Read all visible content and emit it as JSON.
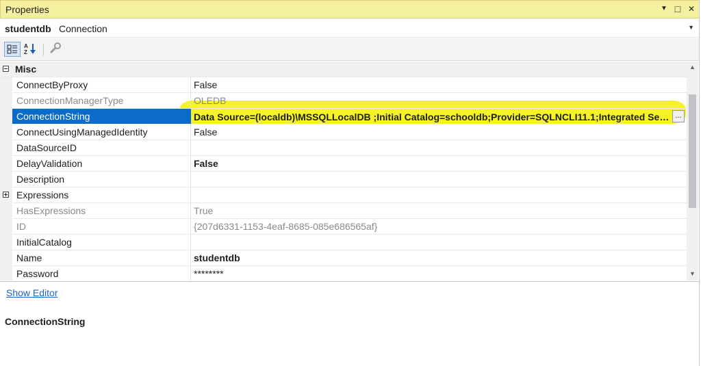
{
  "window": {
    "title": "Properties",
    "dropdown_glyph": "▼",
    "maximize_glyph": "□",
    "close_glyph": "✕"
  },
  "object_selector": {
    "name": "studentdb",
    "type": "Connection"
  },
  "toolbar": {
    "categorized_icon": "categorized-icon",
    "alphabetical_icon": "alphabetical-icon",
    "property_pages_icon": "wrench-icon"
  },
  "grid": {
    "category": "Misc",
    "rows": [
      {
        "name": "ConnectByProxy",
        "value": "False"
      },
      {
        "name": "ConnectionManagerType",
        "value": "OLEDB"
      },
      {
        "name": "ConnectionString",
        "value": "Data Source=(localdb)\\MSSQLLocalDB ;Initial Catalog=schooldb;Provider=SQLNCLI11.1;Integrated Security=SSPI;Auto Translate=False;",
        "ellipsis": "..."
      },
      {
        "name": "ConnectUsingManagedIdentity",
        "value": "False"
      },
      {
        "name": "DataSourceID",
        "value": ""
      },
      {
        "name": "DelayValidation",
        "value": "False"
      },
      {
        "name": "Description",
        "value": ""
      },
      {
        "name": "Expressions",
        "value": ""
      },
      {
        "name": "HasExpressions",
        "value": "True"
      },
      {
        "name": "ID",
        "value": "{207d6331-1153-4eaf-8685-085e686565af}"
      },
      {
        "name": "InitialCatalog",
        "value": ""
      },
      {
        "name": "Name",
        "value": "studentdb"
      },
      {
        "name": "Password",
        "value": "********"
      }
    ]
  },
  "footer": {
    "show_editor": "Show Editor",
    "description_title": "ConnectionString"
  },
  "colors": {
    "selection": "#0a6cc8",
    "highlight": "#f4f21c",
    "titlebar": "#f5f0a0",
    "link": "#1a62c4"
  }
}
